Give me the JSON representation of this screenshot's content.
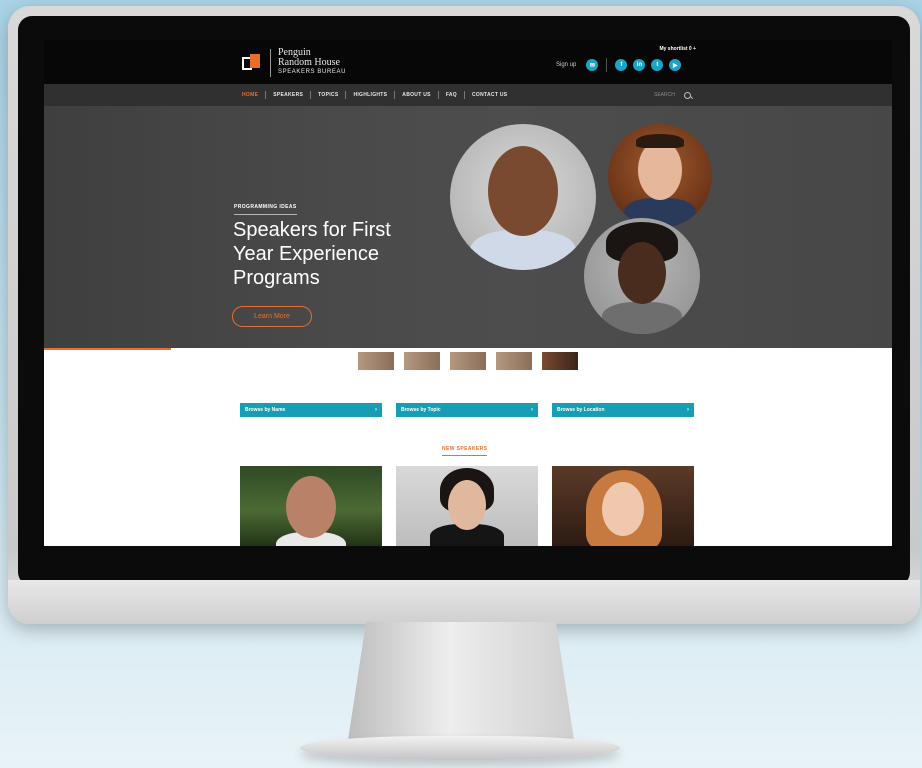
{
  "brand": {
    "line1": "Penguin",
    "line2": "Random House",
    "line3": "SPEAKERS BUREAU"
  },
  "header": {
    "shortlist": "My shortlist 0 +",
    "signup": "Sign up",
    "social_icons": [
      "email-icon",
      "facebook-icon",
      "linkedin-icon",
      "twitter-icon",
      "youtube-icon"
    ],
    "social_glyphs": [
      "✉",
      "f",
      "in",
      "t",
      "▶"
    ]
  },
  "nav": {
    "items": [
      "HOME",
      "SPEAKERS",
      "TOPICS",
      "HIGHLIGHTS",
      "ABOUT US",
      "FAQ",
      "CONTACT US"
    ],
    "active": "HOME",
    "search_placeholder": "SEARCH"
  },
  "hero": {
    "eyebrow": "PROGRAMMING IDEAS",
    "title": "Speakers for First Year Experience Programs",
    "cta": "Learn More",
    "slide_progress": 0.15
  },
  "browse": [
    {
      "label": "Browse by Name"
    },
    {
      "label": "Browse by Topic"
    },
    {
      "label": "Browse by Location"
    }
  ],
  "new_speakers": {
    "heading": "NEW SPEAKERS"
  },
  "colors": {
    "accent": "#e8702a",
    "teal": "#189eb4",
    "social": "#19a4c8",
    "topbar": "#070707",
    "navbar": "#303030"
  }
}
